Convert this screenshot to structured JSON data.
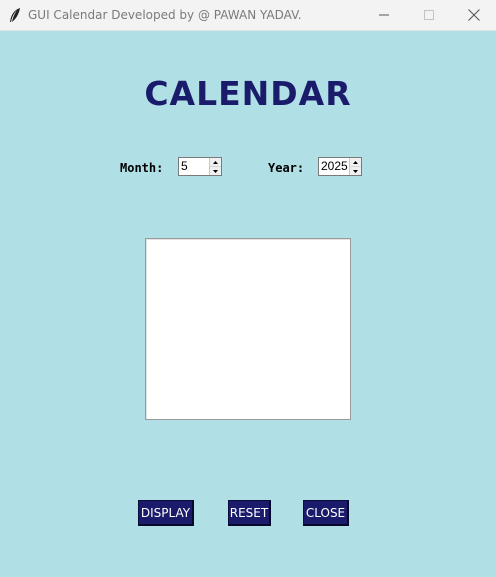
{
  "window": {
    "title": "GUI Calendar Developed by @ PAWAN YADAV.",
    "icon": "feather-icon"
  },
  "heading": "CALENDAR",
  "month": {
    "label": "Month:",
    "value": "5"
  },
  "year": {
    "label": "Year:",
    "value": "2025"
  },
  "calendar_display": {
    "content": ""
  },
  "buttons": {
    "display": "DISPLAY",
    "reset": "RESET",
    "close": "CLOSE"
  },
  "colors": {
    "background": "#b0dfe5",
    "heading": "#1a1b6b",
    "button_bg": "#1a1b6b",
    "button_text": "#ffffff"
  }
}
